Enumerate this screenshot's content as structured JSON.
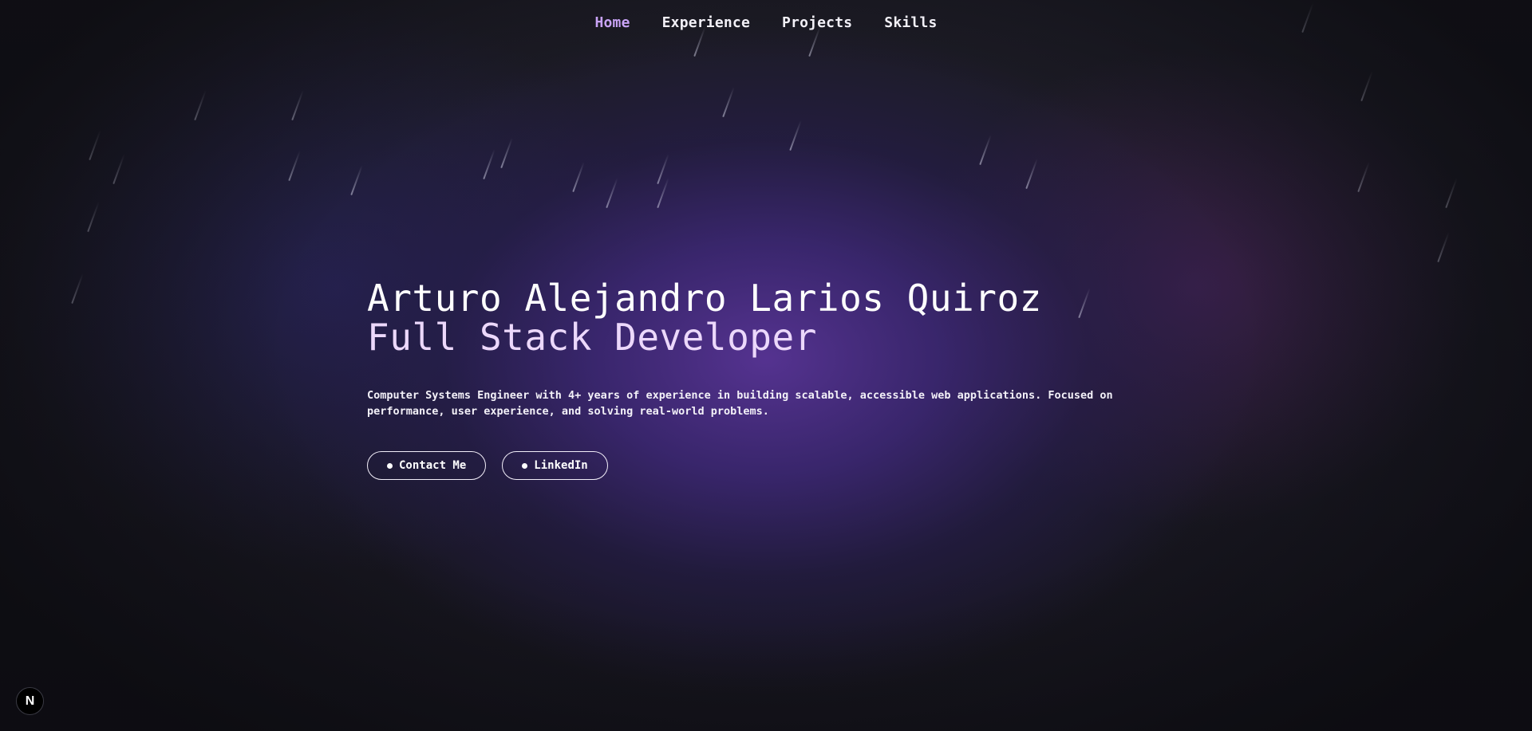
{
  "nav": {
    "items": [
      {
        "label": "Home",
        "active": true
      },
      {
        "label": "Experience",
        "active": false
      },
      {
        "label": "Projects",
        "active": false
      },
      {
        "label": "Skills",
        "active": false
      }
    ]
  },
  "hero": {
    "name": "Arturo Alejandro Larios Quiroz",
    "role": "Full Stack Developer",
    "description": "Computer Systems Engineer with 4+ years of experience in building scalable, accessible web applications. Focused on performance, user experience, and solving real-world problems.",
    "buttons": {
      "contact_label": "Contact Me",
      "linkedin_label": "LinkedIn"
    }
  },
  "badge": {
    "letter": "N",
    "icon": "nextjs-icon"
  },
  "colors": {
    "accent": "#c9a3f6",
    "role_text": "#ecd8fb",
    "background": "#131318",
    "glow": "#58349a"
  }
}
